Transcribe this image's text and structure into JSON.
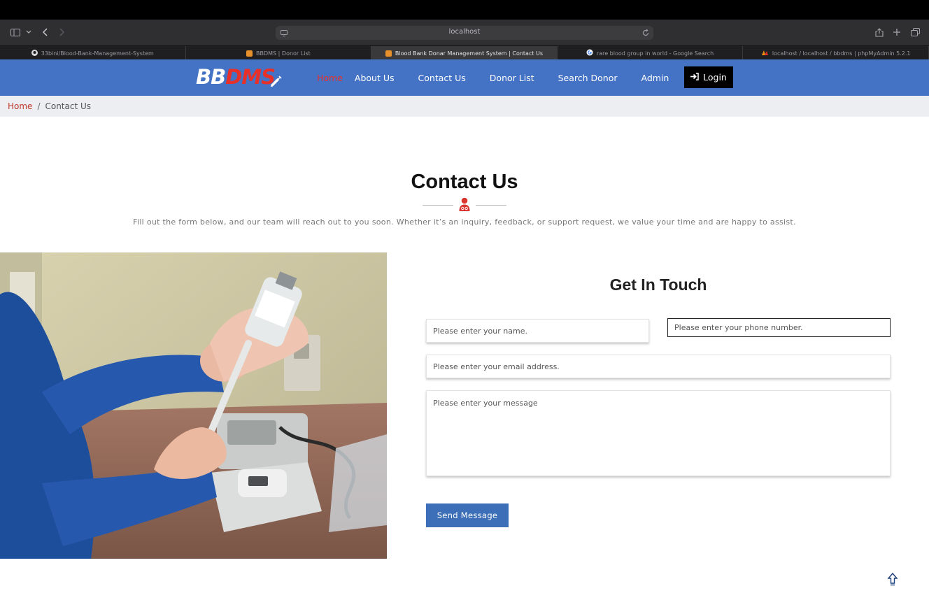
{
  "browser": {
    "url": "localhost",
    "tabs": [
      {
        "label": "33bini/Blood-Bank-Management-System",
        "icon": "github-icon",
        "active": false
      },
      {
        "label": "BBDMS | Donor List",
        "icon": "site-favicon-icon",
        "active": false
      },
      {
        "label": "Blood Bank Donar Management System | Contact Us",
        "icon": "site-favicon-icon",
        "active": true
      },
      {
        "label": "rare blood group in world - Google Search",
        "icon": "google-icon",
        "active": false
      },
      {
        "label": "localhost / localhost / bbdms | phpMyAdmin 5.2.1",
        "icon": "phpmyadmin-icon",
        "active": false
      }
    ]
  },
  "header": {
    "logo_part1": "BB",
    "logo_part2": "DMS",
    "nav": {
      "home": "Home",
      "about": "About Us",
      "contact": "Contact Us",
      "donor_list": "Donor List",
      "search_donor": "Search Donor",
      "admin": "Admin"
    },
    "login_label": "Login"
  },
  "breadcrumb": {
    "home": "Home",
    "separator": "/",
    "current": "Contact Us"
  },
  "section": {
    "title": "Contact Us",
    "intro": "Fill out the form below, and our team will reach out to you soon. Whether it’s an inquiry, feedback, or support request, we value your time and are happy to assist."
  },
  "form": {
    "title": "Get In Touch",
    "name_placeholder": "Please enter your name.",
    "phone_placeholder": "Please enter your phone number.",
    "email_placeholder": "Please enter your email address.",
    "message_placeholder": "Please enter your message",
    "send_label": "Send Message"
  },
  "colors": {
    "header_bg": "#4472c4",
    "accent_red": "#e8302b",
    "button_blue": "#3d6fb8",
    "breadcrumb_bg": "#eceef1"
  }
}
